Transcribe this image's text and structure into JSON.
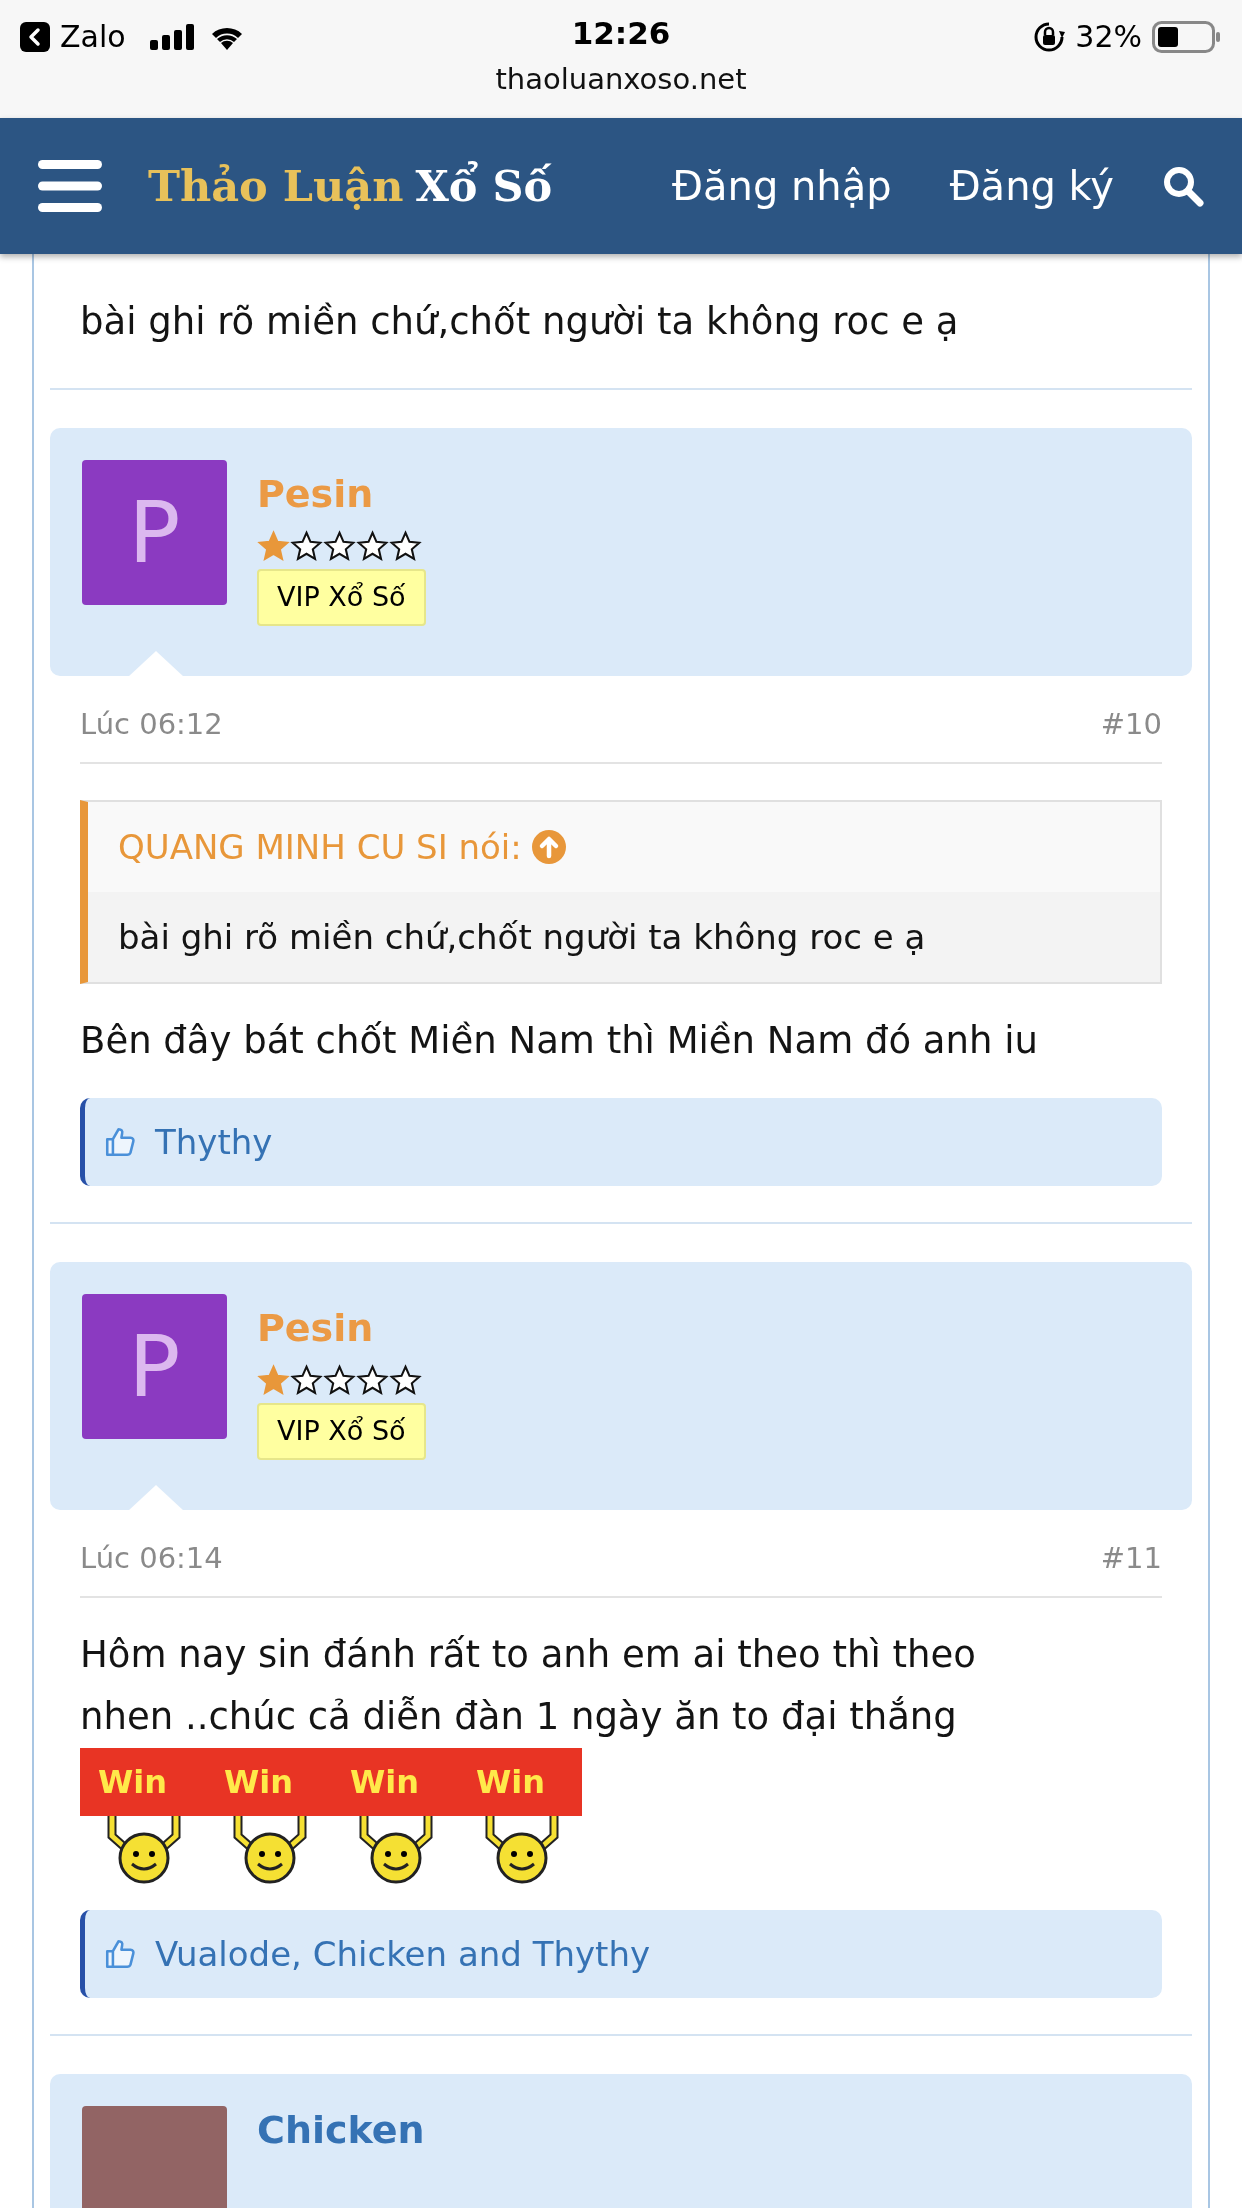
{
  "status_bar": {
    "back_app": "Zalo",
    "time": "12:26",
    "battery": "32%",
    "url": "thaoluanxoso.net"
  },
  "header": {
    "logo": [
      "Thảo Luận",
      "Xổ Số"
    ],
    "links": [
      "Đăng nhập",
      "Đăng ký"
    ]
  },
  "partial_post": {
    "message": "bài ghi rõ miền chứ,chốt người ta không roc e ạ"
  },
  "posts": [
    {
      "author": "Pesin",
      "avatar_letter": "P",
      "color": "#8b3ac1",
      "stars": 1,
      "badge": "VIP Xổ Số",
      "time": "Lúc 06:12",
      "number": "#10",
      "quote": {
        "author": "QUANG MINH CU SI nói:",
        "text": "bài ghi rõ miền chứ,chốt người ta không roc e ạ"
      },
      "message": [
        "Bên đây bát chốt Miền Nam thì Miền Nam đó anh iu"
      ],
      "likes": "Thythy"
    },
    {
      "author": "Pesin",
      "avatar_letter": "P",
      "color": "#8b3ac1",
      "stars": 1,
      "badge": "VIP Xổ Số",
      "time": "Lúc 06:14",
      "number": "#11",
      "message": [
        "Hôm nay sin đánh rất to anh em ai theo thì theo",
        "nhen ..chúc cả diễn đàn 1 ngày ăn to đại thắng"
      ],
      "sticker": [
        "Win",
        "Win",
        "Win",
        "Win"
      ],
      "likes": "Vualode, Chicken and Thythy"
    }
  ],
  "next_post": {
    "author": "Chicken",
    "color": "#926464"
  }
}
